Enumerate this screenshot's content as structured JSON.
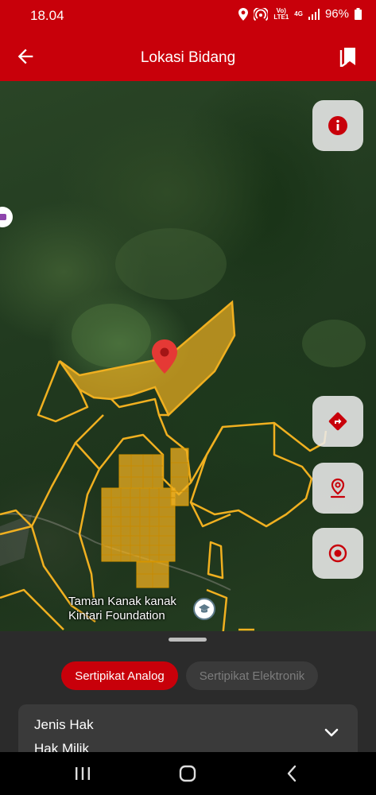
{
  "status_bar": {
    "time": "18.04",
    "net_top": "Vo)",
    "net_bottom": "LTE1",
    "net_gen": "4G",
    "battery": "96%"
  },
  "app_bar": {
    "title": "Lokasi Bidang"
  },
  "map": {
    "place_label_line1": "Taman Kanak kanak",
    "place_label_line2": "Kintari Foundation",
    "accent_color": "#f0b020",
    "marker_color": "#e53935"
  },
  "bottom_sheet": {
    "tabs": [
      {
        "label": "Sertipikat Analog",
        "active": true
      },
      {
        "label": "Sertipikat Elektronik",
        "active": false
      }
    ],
    "field_label": "Jenis Hak",
    "field_value": "Hak Milik"
  },
  "colors": {
    "primary": "#c8000a",
    "sheet_bg": "#2b2b2b",
    "card_bg": "#3a3a3a"
  }
}
